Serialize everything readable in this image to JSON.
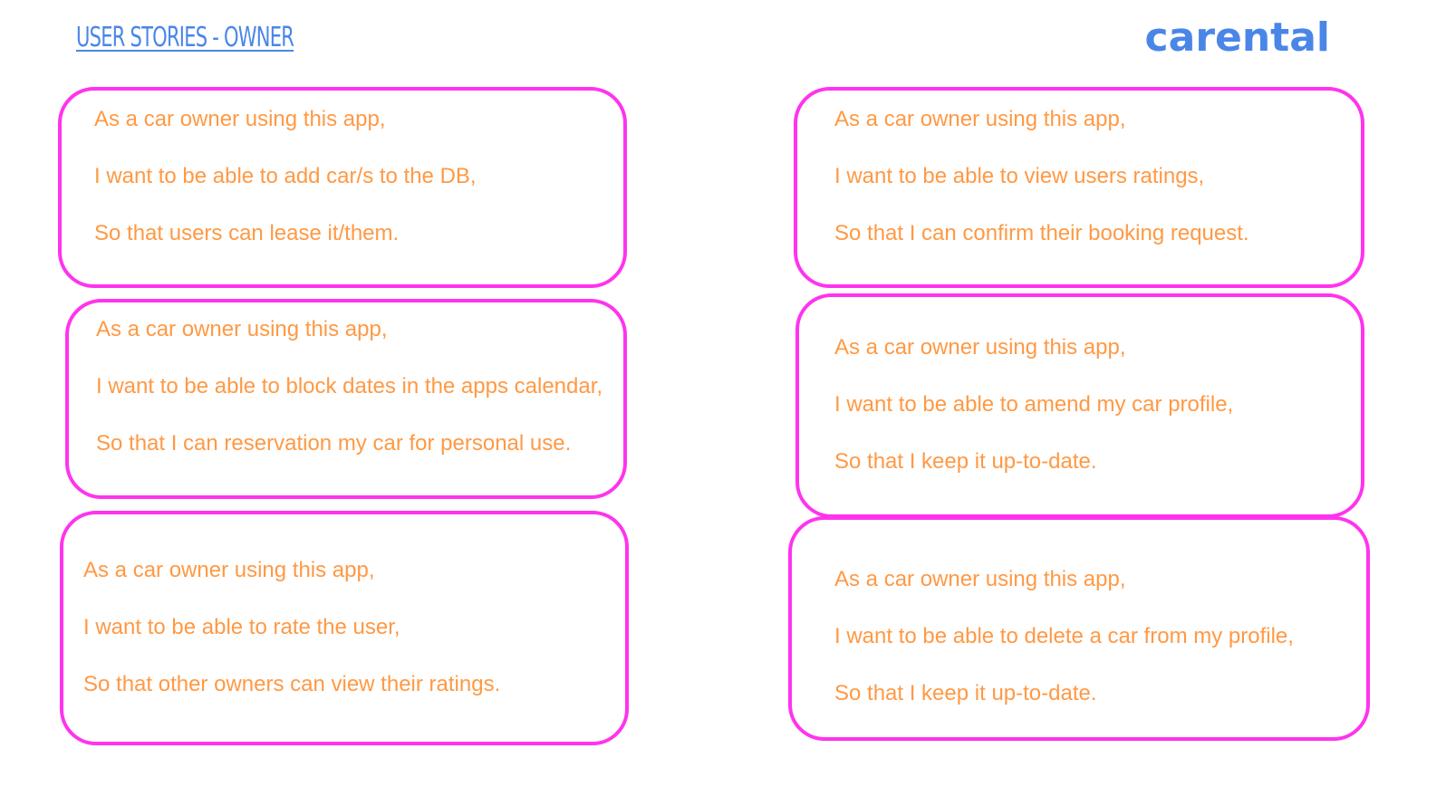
{
  "header": {
    "title": "USER STORIES - OWNER",
    "brand": "carental"
  },
  "colors": {
    "accent_blue": "#4a86e8",
    "card_border": "#ff33ee",
    "story_text": "#ff9944"
  },
  "stories": [
    {
      "line1": "As a car owner using this app,",
      "line2": "I want to be able to add car/s to the DB,",
      "line3": "So that users can lease it/them."
    },
    {
      "line1": "As a car owner using this app,",
      "line2": "I want to be able to block dates in the apps calendar,",
      "line3": "So that I can reservation my car for personal use."
    },
    {
      "line1": "As a car owner using this app,",
      "line2": "I want to be able to rate the user,",
      "line3": "So that other owners can view their ratings."
    },
    {
      "line1": "As a car owner using this app,",
      "line2": "I want to be able to view users ratings,",
      "line3": "So that I can confirm their booking request."
    },
    {
      "line1": "As a car owner using this app,",
      "line2": "I want to be able to amend my car profile,",
      "line3": "So that I keep it up-to-date."
    },
    {
      "line1": "As a car owner using this app,",
      "line2": "I want to be able to delete a car from my profile,",
      "line3": "So that I keep it up-to-date."
    }
  ]
}
